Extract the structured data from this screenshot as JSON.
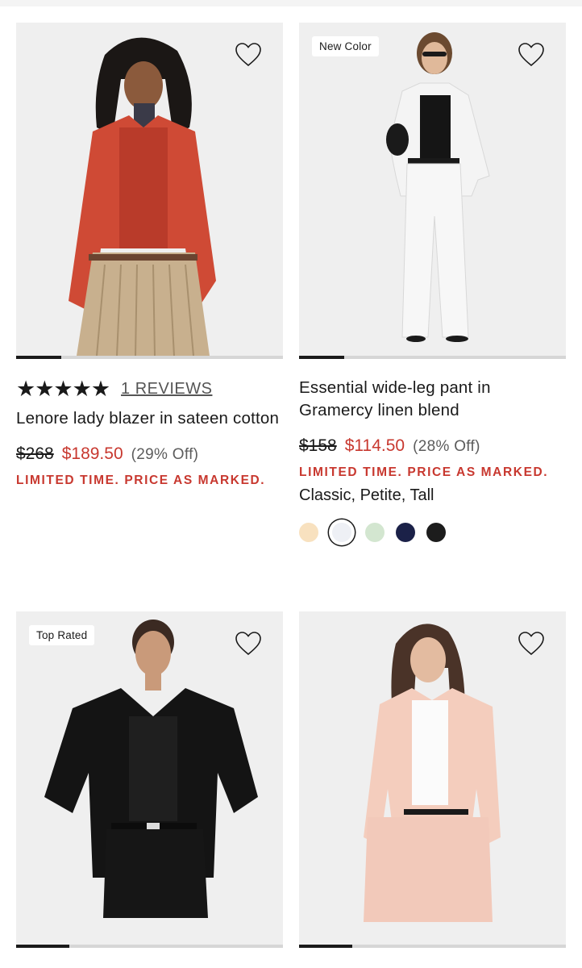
{
  "products": [
    {
      "badge": "",
      "rating_stars": "★★★★★",
      "reviews": "1 REVIEWS",
      "name": "Lenore lady blazer in sateen cotton",
      "price_original": "$268",
      "price_sale": "$189.50",
      "price_off": "(29% Off)",
      "promo": "LIMITED TIME. PRICE AS MARKED.",
      "image_progress": 0.17
    },
    {
      "badge": "New Color",
      "name": "Essential wide-leg pant in Gramercy linen blend",
      "price_original": "$158",
      "price_sale": "$114.50",
      "price_off": "(28% Off)",
      "promo": "LIMITED TIME. PRICE AS MARKED.",
      "fits": "Classic, Petite, Tall",
      "swatches": [
        "#f8e1bf",
        "#eef0f5",
        "#d3e6d0",
        "#1b2148",
        "#1c1c1c"
      ],
      "selected_swatch": 1,
      "image_progress": 0.17
    },
    {
      "badge": "Top Rated",
      "image_progress": 0.2
    },
    {
      "badge": "",
      "image_progress": 0.2
    }
  ],
  "icons": {
    "favorite": "heart-outline-icon"
  }
}
